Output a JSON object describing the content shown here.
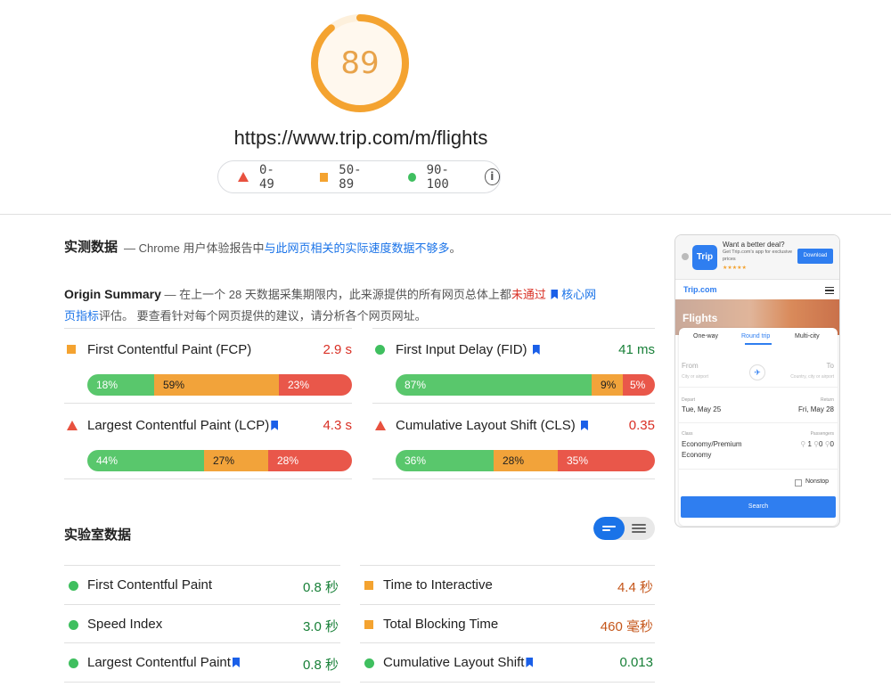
{
  "score": {
    "value": "89",
    "fraction": 0.89,
    "color": "#f4a330"
  },
  "url": "https://www.trip.com/m/flights",
  "legend": {
    "poor": "0-49",
    "average": "50-89",
    "good": "90-100",
    "info_icon": "info-icon"
  },
  "field": {
    "title": "实测数据",
    "desc_prefix": " — Chrome 用户体验报告中",
    "desc_link": "与此网页相关的实际速度数据不够多",
    "desc_suffix": "。"
  },
  "origin": {
    "title": "Origin Summary",
    "desc_1": " — 在上一个 28 天数据采集期限内，此来源提供的所有网页总体上都",
    "fail": "未通过",
    "link_1": "核心网",
    "link_2": "页指标",
    "desc_2": "评估。 要查看针对每个网页提供的建议，请分析各个网页网址。"
  },
  "field_metrics": [
    {
      "name": "First Contentful Paint (FCP)",
      "value": "2.9 s",
      "status": "average",
      "bookmark": false,
      "dist": [
        "18%",
        "59%",
        "23%"
      ],
      "fracs": [
        0.18,
        0.59,
        0.23
      ]
    },
    {
      "name": "First Input Delay (FID)",
      "value": "41 ms",
      "status": "good",
      "bookmark": true,
      "dist": [
        "87%",
        "9%",
        "5%"
      ],
      "fracs": [
        0.87,
        0.09,
        0.05
      ]
    },
    {
      "name": "Largest Contentful Paint (LCP)",
      "value": "4.3 s",
      "status": "poor",
      "bookmark": true,
      "dist": [
        "44%",
        "27%",
        "28%"
      ],
      "fracs": [
        0.44,
        0.27,
        0.28
      ]
    },
    {
      "name": "Cumulative Layout Shift (CLS)",
      "value": "0.35",
      "status": "poor",
      "bookmark": true,
      "dist": [
        "36%",
        "28%",
        "35%"
      ],
      "fracs": [
        0.36,
        0.28,
        0.35
      ]
    }
  ],
  "lab": {
    "title": "实验室数据",
    "metrics": [
      {
        "name": "First Contentful Paint",
        "value": "0.8 秒",
        "status": "good",
        "bookmark": false
      },
      {
        "name": "Time to Interactive",
        "value": "4.4 秒",
        "status": "average",
        "bookmark": false
      },
      {
        "name": "Speed Index",
        "value": "3.0 秒",
        "status": "good",
        "bookmark": false
      },
      {
        "name": "Total Blocking Time",
        "value": "460 毫秒",
        "status": "average",
        "bookmark": false
      },
      {
        "name": "Largest Contentful Paint",
        "value": "0.8 秒",
        "status": "good",
        "bookmark": true
      },
      {
        "name": "Cumulative Layout Shift",
        "value": "0.013",
        "status": "good",
        "bookmark": true
      }
    ]
  },
  "thumbnail": {
    "app_logo": "Trip",
    "deal_title": "Want a better deal?",
    "deal_sub": "Get Trip.com's app for exclusive prices",
    "stars": "★★★★★",
    "download": "Download",
    "brand": "Trip.com",
    "hero": "Flights",
    "tabs": [
      "One-way",
      "Round trip",
      "Multi-city"
    ],
    "from_label": "From",
    "from_hint": "City or airport",
    "to_label": "To",
    "to_hint": "Country, city or airport",
    "depart_label": "Depart",
    "depart_value": "Tue, May 25",
    "return_label": "Return",
    "return_value": "Fri, May 28",
    "class_label": "Class",
    "class_value": "Economy/Premium Economy",
    "passengers_label": "Passengers",
    "passengers": [
      "1",
      "0",
      "0"
    ],
    "nonstop": "Nonstop",
    "search": "Search"
  }
}
